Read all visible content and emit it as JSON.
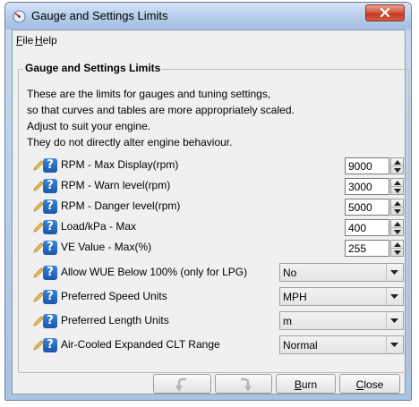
{
  "window": {
    "title": "Gauge and Settings Limits"
  },
  "menu": [
    {
      "label": "File"
    },
    {
      "label": "Help"
    }
  ],
  "group": {
    "title": "Gauge and Settings Limits",
    "description": [
      "These are the limits for gauges and tuning settings,",
      "so that curves and tables are more appropriately scaled.",
      "Adjust to suit your engine.",
      "They do not directly alter engine behaviour."
    ]
  },
  "fields": [
    {
      "label": "RPM - Max Display(rpm)",
      "value": "9000"
    },
    {
      "label": "RPM - Warn level(rpm)",
      "value": "3000"
    },
    {
      "label": "RPM - Danger level(rpm)",
      "value": "5000"
    },
    {
      "label": "Load/kPa - Max",
      "value": "400"
    },
    {
      "label": "VE Value - Max(%)",
      "value": "255"
    }
  ],
  "selects": [
    {
      "label": "Allow WUE Below 100% (only for LPG)",
      "value": "No"
    },
    {
      "label": "Preferred Speed Units",
      "value": "MPH"
    },
    {
      "label": "Preferred Length Units",
      "value": "m"
    },
    {
      "label": "Air-Cooled Expanded CLT Range",
      "value": "Normal"
    }
  ],
  "buttons": {
    "burn": "Burn",
    "close": "Close"
  },
  "icons": {
    "pencil": "pencil-icon",
    "help": "help-icon",
    "undo": "undo-icon",
    "redo": "redo-icon"
  },
  "colors": {
    "help_icon": "#1b57a8",
    "title_close": "#c53a22",
    "titlebar": "#b7cdea"
  }
}
